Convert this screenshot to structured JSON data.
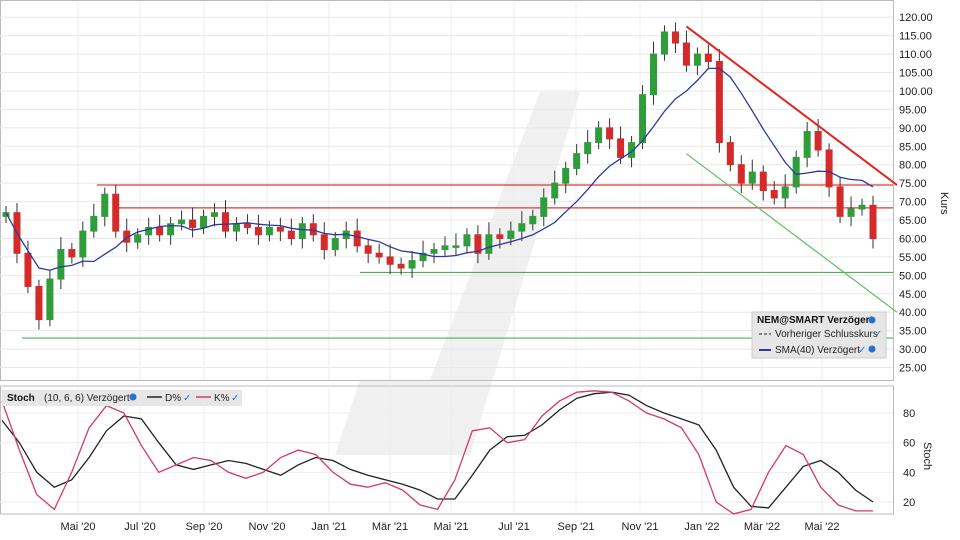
{
  "chart_data": [
    {
      "type": "candlestick",
      "axis_name": "Kurs",
      "ylim": [
        20,
        122.5
      ],
      "y_ticks": [
        "120.00",
        "115.00",
        "110.00",
        "105.00",
        "100.00",
        "95.00",
        "90.00",
        "85.00",
        "80.00",
        "75.00",
        "70.00",
        "65.00",
        "60.00",
        "55.00",
        "50.00",
        "45.00",
        "40.00",
        "35.00",
        "30.00",
        "25.00"
      ],
      "x_ticks": [
        "Mai '20",
        "Jul '20",
        "Sep '20",
        "Nov '20",
        "Jan '21",
        "Mär '21",
        "Mai '21",
        "Jul '21",
        "Sep '21",
        "Nov '21",
        "Jan '22",
        "Mär '22",
        "Mai '22"
      ],
      "grid": true,
      "legend_placement": "bottom-right",
      "legend": {
        "title": "NEM@SMART Verzögert",
        "items": [
          "Vorheriger Schlusskurs",
          "SMA(40) Verzögert"
        ]
      },
      "colors": {
        "up": "#2e9d3a",
        "down": "#d42a2a",
        "sma": "#2c3a9e"
      },
      "closes": [
        67,
        56,
        47,
        38,
        49,
        57,
        55,
        62,
        66,
        72,
        62,
        59,
        61,
        63,
        61,
        64,
        65,
        63,
        66,
        67,
        62,
        64,
        63,
        61,
        63,
        62,
        60,
        64,
        61,
        57,
        60,
        62,
        58,
        56,
        55,
        53,
        52,
        54,
        56,
        57,
        58,
        58,
        61,
        56,
        61,
        60,
        62,
        64,
        66,
        71,
        75,
        79,
        83,
        86,
        90,
        87,
        82,
        86,
        99,
        110,
        116,
        113,
        107,
        110,
        108,
        86,
        80,
        75,
        78,
        73,
        71,
        74,
        82,
        89,
        84,
        74,
        66,
        68,
        69,
        60
      ],
      "sma40_note": "dark blue line",
      "horizontal_lines": [
        {
          "level": 74.5,
          "color": "#e03a3a"
        },
        {
          "level": 68.3,
          "color": "#e03a3a"
        },
        {
          "level": 50.8,
          "color": "#4caf50"
        },
        {
          "level": 33.0,
          "color": "#4caf50"
        }
      ],
      "trend_lines": [
        {
          "from": [
            62,
            117.5
          ],
          "to": [
            80,
            74.5
          ],
          "color": "#e02424"
        },
        {
          "from": [
            62,
            83
          ],
          "to": [
            80,
            41
          ],
          "color": "#5fbf5f"
        }
      ]
    },
    {
      "type": "line",
      "axis_name": "Stoch",
      "ylim": [
        0,
        100
      ],
      "y_ticks": [
        "80",
        "60",
        "40",
        "20"
      ],
      "legend_placement": "top-left",
      "legend": {
        "title": "Stoch",
        "params": "(10, 6, 6) Verzögert",
        "items": [
          "D%",
          "K%"
        ]
      },
      "series": [
        {
          "name": "D%",
          "color": "#222222",
          "values": [
            75,
            60,
            40,
            30,
            35,
            50,
            68,
            78,
            76,
            60,
            45,
            42,
            45,
            48,
            46,
            42,
            38,
            45,
            50,
            48,
            42,
            38,
            35,
            32,
            28,
            22,
            22,
            38,
            55,
            64,
            65,
            72,
            82,
            90,
            93,
            94,
            92,
            85,
            80,
            76,
            72,
            55,
            30,
            17,
            16,
            30,
            44,
            48,
            40,
            28,
            20
          ]
        },
        {
          "name": "K%",
          "color": "#d43a62",
          "values": [
            88,
            55,
            25,
            15,
            40,
            70,
            85,
            80,
            58,
            40,
            45,
            50,
            48,
            40,
            36,
            40,
            50,
            55,
            52,
            40,
            32,
            30,
            33,
            28,
            18,
            15,
            35,
            68,
            70,
            60,
            62,
            78,
            88,
            94,
            95,
            94,
            88,
            80,
            76,
            70,
            52,
            20,
            12,
            15,
            40,
            58,
            52,
            30,
            18,
            14,
            14
          ]
        }
      ]
    }
  ]
}
